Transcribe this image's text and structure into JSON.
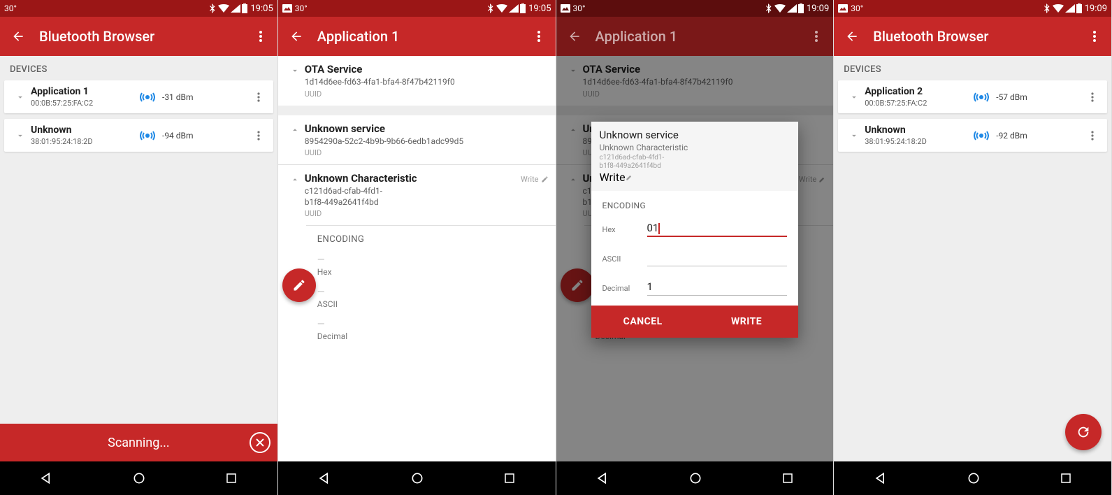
{
  "status": {
    "temp": "30°",
    "time_a": "19:05",
    "time_b": "19:09"
  },
  "appbar": {
    "browser_title": "Bluetooth Browser",
    "app1_title": "Application 1"
  },
  "labels": {
    "devices": "DEVICES",
    "encoding": "ENCODING",
    "uuid": "UUID",
    "write": "Write",
    "scanning": "Scanning...",
    "cancel": "CANCEL",
    "write_caps": "WRITE",
    "hex": "Hex",
    "ascii": "ASCII",
    "decimal": "Decimal"
  },
  "s1": {
    "devices": [
      {
        "name": "Application 1",
        "mac": "00:0B:57:25:FA:C2",
        "rssi": "-31 dBm"
      },
      {
        "name": "Unknown",
        "mac": "38:01:95:24:18:2D",
        "rssi": "-94 dBm"
      }
    ]
  },
  "s2": {
    "services": [
      {
        "name": "OTA Service",
        "uuid": "1d14d6ee-fd63-4fa1-bfa4-8f47b42119f0"
      },
      {
        "name": "Unknown service",
        "uuid": "8954290a-52c2-4b9b-9b66-6edb1adc99d5"
      }
    ],
    "char": {
      "name": "Unknown Characteristic",
      "uuid": "c121d6ad-cfab-4fd1-b1f8-449a2641f4bd"
    }
  },
  "s3": {
    "dialog": {
      "service": "Unknown service",
      "char": "Unknown Characteristic",
      "uuid": "c121d6ad-cfab-4fd1-b1f8-449a2641f4bd",
      "hex_value": "01",
      "decimal_value": "1"
    }
  },
  "s4": {
    "devices": [
      {
        "name": "Application 2",
        "mac": "00:0B:57:25:FA:C2",
        "rssi": "-57 dBm"
      },
      {
        "name": "Unknown",
        "mac": "38:01:95:24:18:2D",
        "rssi": "-92 dBm"
      }
    ]
  }
}
